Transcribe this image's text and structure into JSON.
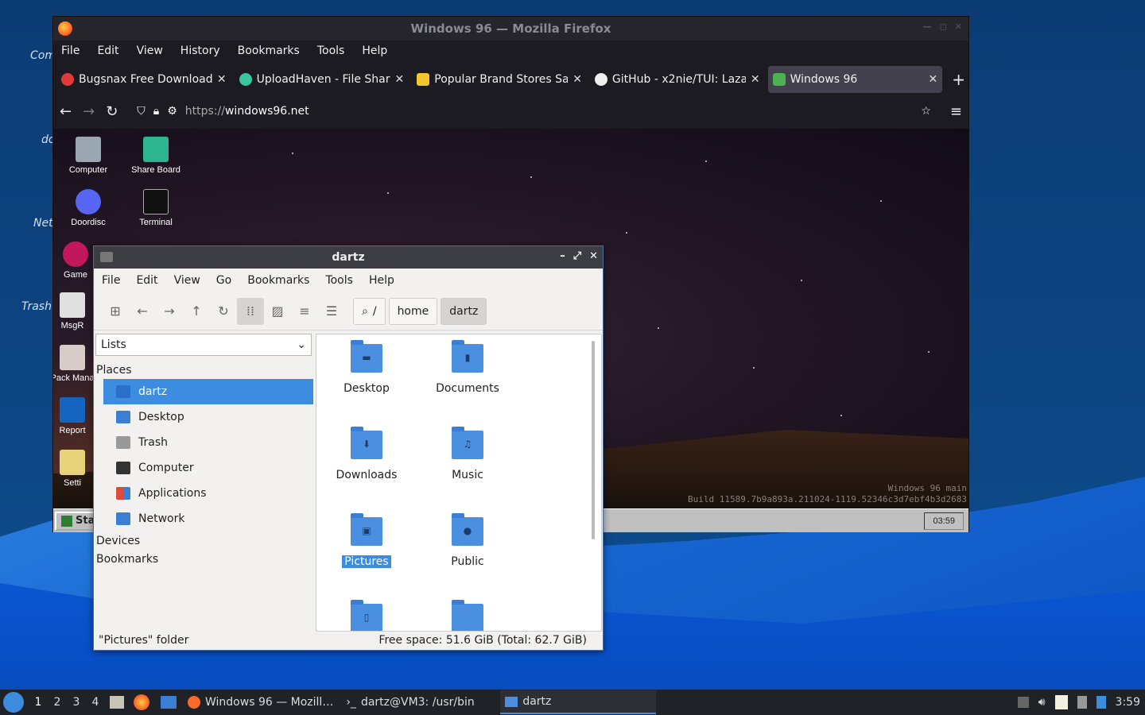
{
  "desktop_icons": [
    "Com",
    "do",
    "Net",
    "Trash"
  ],
  "firefox": {
    "title": "Windows 96 — Mozilla Firefox",
    "menu": [
      "File",
      "Edit",
      "View",
      "History",
      "Bookmarks",
      "Tools",
      "Help"
    ],
    "tabs": [
      {
        "label": "Bugsnax Free Download",
        "color": "#e03a3a"
      },
      {
        "label": "UploadHaven - File Shari",
        "color": "#3ac6a0"
      },
      {
        "label": "Popular Brand Stores Sal",
        "color": "#f4c62e"
      },
      {
        "label": "GitHub - x2nie/TUI: Laza",
        "color": "#eeeeee"
      },
      {
        "label": "Windows 96",
        "color": "#4caf50"
      }
    ],
    "url_scheme": "https://",
    "url_host": "windows96.net"
  },
  "w96": {
    "icons": [
      "Computer",
      "Share Board",
      "Doordisc",
      "Terminal",
      "Game",
      "MsgR",
      "Pack Mana",
      "Report",
      "Setti"
    ],
    "build_line1": "Windows 96 main",
    "build_line2": "Build 11589.7b9a893a.211024-1119.52346c3d7ebf4b3d2683",
    "start_label": "Star",
    "clock": "03:59"
  },
  "fm": {
    "title": "dartz",
    "menu": [
      "File",
      "Edit",
      "View",
      "Go",
      "Bookmarks",
      "Tools",
      "Help"
    ],
    "crumbs": [
      "/",
      "home",
      "dartz"
    ],
    "side_select": "Lists",
    "places_header": "Places",
    "places": [
      {
        "label": "dartz",
        "color": "#4a8fe0"
      },
      {
        "label": "Desktop",
        "color": "#3b7fd4"
      },
      {
        "label": "Trash",
        "color": "#999999"
      },
      {
        "label": "Computer",
        "color": "#333333"
      },
      {
        "label": "Applications",
        "color": "#e04a3a"
      },
      {
        "label": "Network",
        "color": "#3b7fd4"
      }
    ],
    "devices_header": "Devices",
    "bookmarks_header": "Bookmarks",
    "items": [
      {
        "label": "Desktop",
        "mark": "▬"
      },
      {
        "label": "Documents",
        "mark": "▮"
      },
      {
        "label": "Downloads",
        "mark": "⬇"
      },
      {
        "label": "Music",
        "mark": "♫"
      },
      {
        "label": "Pictures",
        "mark": "▣"
      },
      {
        "label": "Public",
        "mark": "●"
      },
      {
        "label": "",
        "mark": "▯"
      },
      {
        "label": "",
        "mark": ""
      }
    ],
    "status_left": "\"Pictures\" folder",
    "status_right": "Free space: 51.6 GiB (Total: 62.7 GiB)"
  },
  "taskbar": {
    "workspaces": [
      "1",
      "2",
      "3",
      "4"
    ],
    "windows": [
      "Windows 96 — Mozill…",
      "dartz@VM3: /usr/bin",
      "dartz"
    ],
    "clock": "3:59"
  }
}
